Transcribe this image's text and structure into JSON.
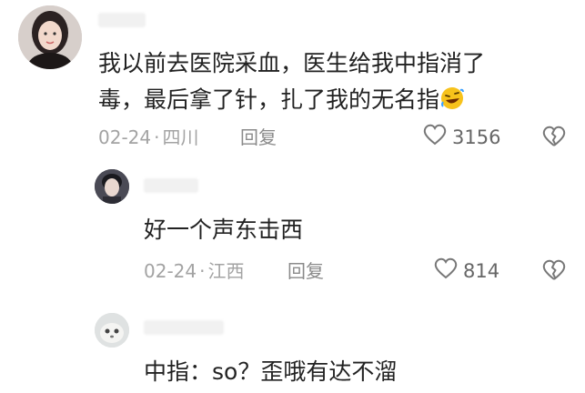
{
  "comments": [
    {
      "text_line1": "我以前去医院采血，医生给我中指消了",
      "text_line2": "毒，最后拿了针，扎了我的无名指",
      "emoji": "rofl-emoji",
      "date": "02-24",
      "location": "四川",
      "reply_label": "回复",
      "likes": "3156"
    },
    {
      "text": "好一个声东击西",
      "date": "02-24",
      "location": "江西",
      "reply_label": "回复",
      "likes": "814"
    },
    {
      "text": "中指：so？歪哦有达不溜"
    }
  ],
  "colors": {
    "text": "#222222",
    "meta": "#a3a3a3",
    "icon": "#777777",
    "emoji_face": "#f7c21b"
  }
}
